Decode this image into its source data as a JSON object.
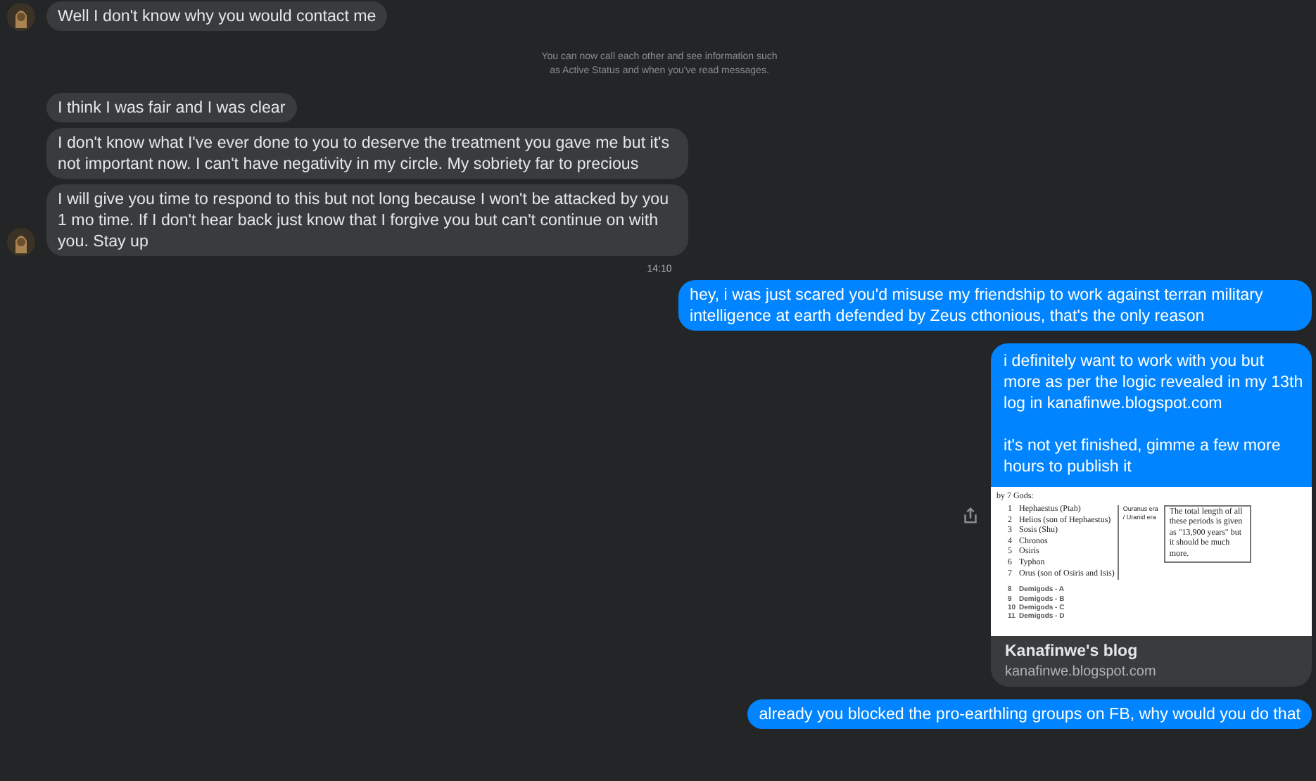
{
  "messages": [
    {
      "kind": "incoming",
      "avatar": true,
      "text": "Well I don't know why you would contact me"
    },
    {
      "kind": "system",
      "text": "You can now call each other and see information such as Active Status and when you've read messages."
    },
    {
      "kind": "incoming",
      "avatar": false,
      "text": "I think I was fair and I was clear"
    },
    {
      "kind": "incoming",
      "avatar": false,
      "text": "I don't know what I've ever done to you to deserve the treatment you gave me but it's not important now. I can't have negativity in my circle. My sobriety far to precious"
    },
    {
      "kind": "incoming",
      "avatar": true,
      "text": "I will give you time to respond to this but not long because I won't be attacked by you 1 mo time. If I don't hear back just know that I forgive you but can't continue on with you. Stay up"
    },
    {
      "kind": "timestamp",
      "text": "14:10"
    },
    {
      "kind": "outgoing",
      "text": "hey, i was just scared you'd misuse my friendship to work against terran military intelligence at earth defended by Zeus cthonious, that's the only reason"
    },
    {
      "kind": "outgoing",
      "text": "i definitely want to work with you but more as per the logic revealed in my 13th log in kanafinwe.blogspot.com\n\nit's not yet finished, gimme a few more hours to publish it",
      "share": true,
      "link_preview": {
        "title": "Kanafinwe's blog",
        "domain": "kanafinwe.blogspot.com",
        "document": {
          "heading": "by 7 Gods:",
          "gods": [
            {
              "num": "1",
              "name": "Hephaestus (Ptah)"
            },
            {
              "num": "2",
              "name": "Helios (son of Hephaestus)"
            },
            {
              "num": "3",
              "name": "Sosis (Shu)"
            },
            {
              "num": "4",
              "name": "Chronos"
            },
            {
              "num": "5",
              "name": "Osiris"
            },
            {
              "num": "6",
              "name": "Typhon"
            },
            {
              "num": "7",
              "name": "Orus (son of Osiris and Isis)"
            }
          ],
          "era_label": "Ouranus era / Uranid era",
          "note": "The total length of all these periods is given as \"13,900 years\" but it should be much more.",
          "demigods": [
            {
              "num": "8",
              "name": "Demigods - A"
            },
            {
              "num": "9",
              "name": "Demigods - B"
            },
            {
              "num": "10",
              "name": "Demigods - C"
            },
            {
              "num": "11",
              "name": "Demigods - D"
            }
          ]
        }
      }
    },
    {
      "kind": "outgoing",
      "text": "already you blocked the pro-earthling groups on FB, why would you do that"
    }
  ]
}
